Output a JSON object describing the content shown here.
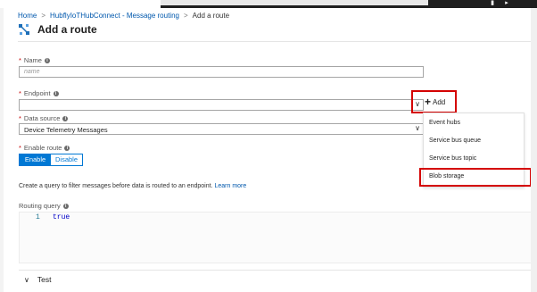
{
  "topbar": {
    "icons": [
      "notifications-icon",
      "shell-icon"
    ]
  },
  "breadcrumb": {
    "items": [
      "Home",
      "HubflyIoTHubConnect - Message routing",
      "Add a route"
    ],
    "separator": ">"
  },
  "page": {
    "title": "Add a route",
    "icon": "route-icon"
  },
  "form": {
    "name": {
      "label": "Name",
      "required": "*",
      "placeholder": "name",
      "value": ""
    },
    "endpoint": {
      "label": "Endpoint",
      "required": "*",
      "value": "",
      "add_label": "Add"
    },
    "data_source": {
      "label": "Data source",
      "required": "*",
      "value": "Device Telemetry Messages"
    },
    "enable_route": {
      "label": "Enable route",
      "required": "*",
      "options": [
        "Enable",
        "Disable"
      ],
      "selected": "Enable"
    },
    "help_text": "Create a query to filter messages before data is routed to an endpoint.",
    "help_link": "Learn more",
    "routing_query": {
      "label": "Routing query",
      "line_number": "1",
      "code": "true"
    },
    "test_section": "Test"
  },
  "endpoint_menu": {
    "items": [
      "Event hubs",
      "Service bus queue",
      "Service bus topic",
      "Blob storage"
    ]
  },
  "highlights": {
    "color": "#d40000"
  },
  "colors": {
    "accent": "#0078d4",
    "link": "#0058ad"
  }
}
